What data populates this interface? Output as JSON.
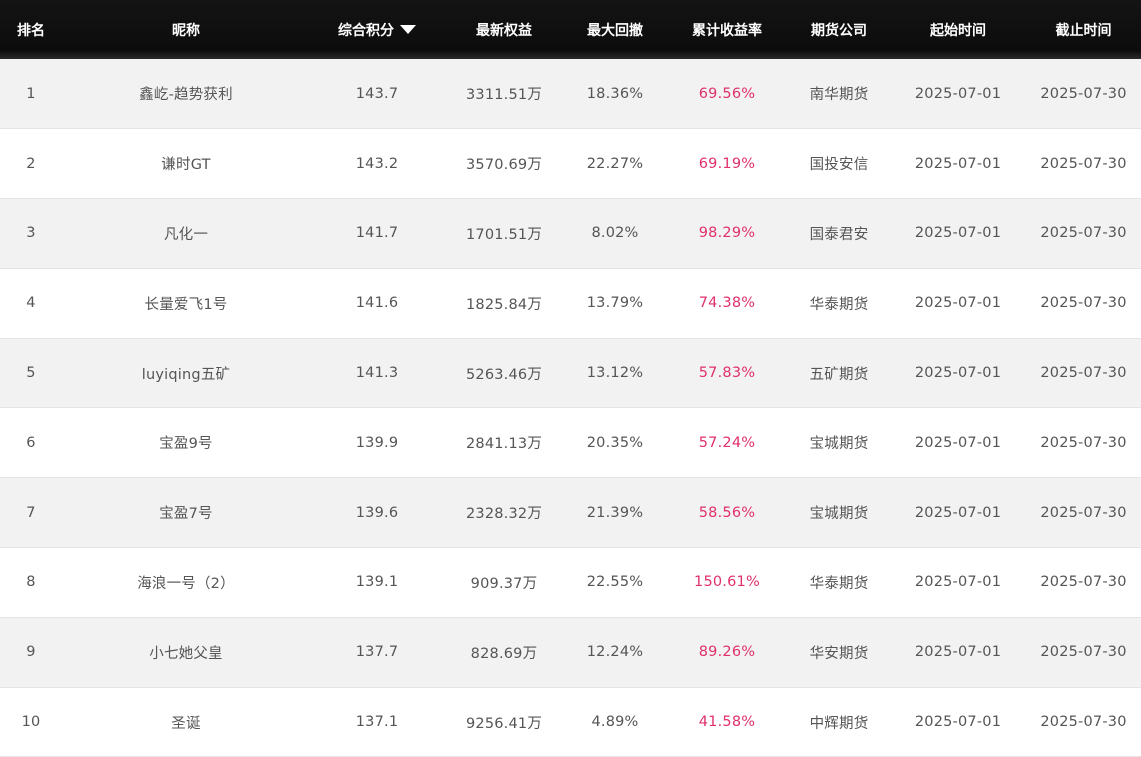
{
  "table": {
    "headers": {
      "rank": "排名",
      "nickname": "昵称",
      "score": "综合积分",
      "equity": "最新权益",
      "drawdown": "最大回撤",
      "yield": "累计收益率",
      "company": "期货公司",
      "start": "起始时间",
      "end": "截止时间"
    },
    "sort": {
      "column": "综合积分",
      "direction": "descending",
      "icon": "sort-down-triangle-icon"
    },
    "colors": {
      "header_bg": "#111111",
      "yield_text": "#e0306e",
      "row_alt_bg": "#f2f2f2"
    },
    "rows": [
      {
        "rank": "1",
        "nickname": "鑫屹-趋势获利",
        "score": "143.7",
        "equity": "3311.51万",
        "drawdown": "18.36%",
        "yield": "69.56%",
        "company": "南华期货",
        "start": "2025-07-01",
        "end": "2025-07-30"
      },
      {
        "rank": "2",
        "nickname": "谦时GT",
        "score": "143.2",
        "equity": "3570.69万",
        "drawdown": "22.27%",
        "yield": "69.19%",
        "company": "国投安信",
        "start": "2025-07-01",
        "end": "2025-07-30"
      },
      {
        "rank": "3",
        "nickname": "凡化一",
        "score": "141.7",
        "equity": "1701.51万",
        "drawdown": "8.02%",
        "yield": "98.29%",
        "company": "国泰君安",
        "start": "2025-07-01",
        "end": "2025-07-30"
      },
      {
        "rank": "4",
        "nickname": "长量爱飞1号",
        "score": "141.6",
        "equity": "1825.84万",
        "drawdown": "13.79%",
        "yield": "74.38%",
        "company": "华泰期货",
        "start": "2025-07-01",
        "end": "2025-07-30"
      },
      {
        "rank": "5",
        "nickname": "luyiqing五矿",
        "score": "141.3",
        "equity": "5263.46万",
        "drawdown": "13.12%",
        "yield": "57.83%",
        "company": "五矿期货",
        "start": "2025-07-01",
        "end": "2025-07-30"
      },
      {
        "rank": "6",
        "nickname": "宝盈9号",
        "score": "139.9",
        "equity": "2841.13万",
        "drawdown": "20.35%",
        "yield": "57.24%",
        "company": "宝城期货",
        "start": "2025-07-01",
        "end": "2025-07-30"
      },
      {
        "rank": "7",
        "nickname": "宝盈7号",
        "score": "139.6",
        "equity": "2328.32万",
        "drawdown": "21.39%",
        "yield": "58.56%",
        "company": "宝城期货",
        "start": "2025-07-01",
        "end": "2025-07-30"
      },
      {
        "rank": "8",
        "nickname": "海浪一号（2）",
        "score": "139.1",
        "equity": "909.37万",
        "drawdown": "22.55%",
        "yield": "150.61%",
        "company": "华泰期货",
        "start": "2025-07-01",
        "end": "2025-07-30"
      },
      {
        "rank": "9",
        "nickname": "小七她父皇",
        "score": "137.7",
        "equity": "828.69万",
        "drawdown": "12.24%",
        "yield": "89.26%",
        "company": "华安期货",
        "start": "2025-07-01",
        "end": "2025-07-30"
      },
      {
        "rank": "10",
        "nickname": "圣诞",
        "score": "137.1",
        "equity": "9256.41万",
        "drawdown": "4.89%",
        "yield": "41.58%",
        "company": "中辉期货",
        "start": "2025-07-01",
        "end": "2025-07-30"
      }
    ]
  }
}
